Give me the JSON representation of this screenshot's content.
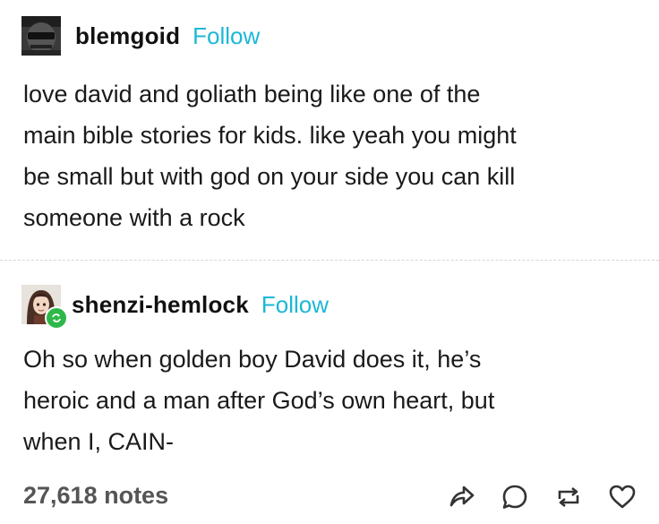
{
  "post1": {
    "username": "blemgoid",
    "follow_label": "Follow",
    "avatar_icon": "masked-face-avatar",
    "lines": [
      "love david and goliath being like one of the",
      "main bible stories for kids. like yeah you might",
      "be small but with god on your side you can kill",
      "someone with a rock"
    ]
  },
  "post2": {
    "username": "shenzi-hemlock",
    "follow_label": "Follow",
    "avatar_icon": "anime-girl-avatar",
    "badge_icon": "reblog-badge-icon",
    "lines": [
      "Oh so when golden boy David does it, he’s",
      "heroic and a man after God’s own heart, but",
      "when I, CAIN-"
    ]
  },
  "footer": {
    "notes": "27,618 notes",
    "actions": [
      "share-icon",
      "reply-icon",
      "reblog-icon",
      "like-icon"
    ]
  },
  "colors": {
    "follow": "#1bb8d6",
    "text": "#1a1a1a",
    "notes": "#555555",
    "badge": "#2fb84a"
  }
}
